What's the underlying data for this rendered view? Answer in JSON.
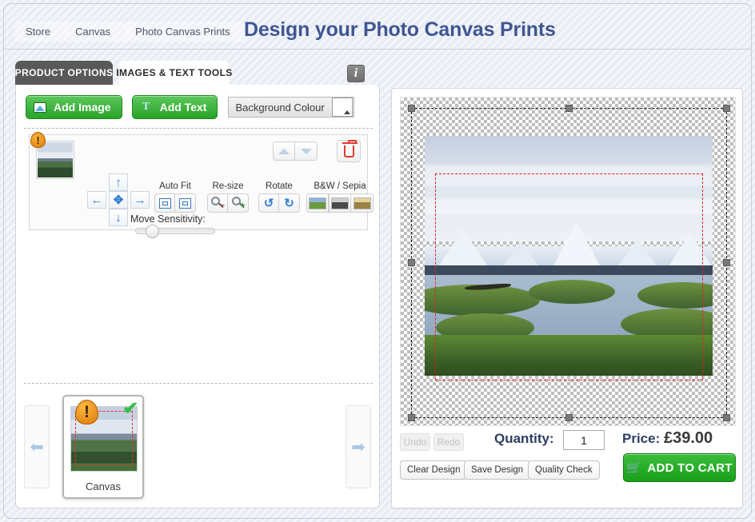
{
  "header": {
    "breadcrumb": [
      {
        "label": "Store"
      },
      {
        "label": "Canvas"
      },
      {
        "label": "Photo Canvas Prints"
      }
    ],
    "title": "Design your Photo Canvas Prints",
    "title_color": "#3f5693"
  },
  "tabs": [
    {
      "label": "PRODUCT OPTIONS",
      "active": false
    },
    {
      "label": "IMAGES & TEXT TOOLS",
      "active": true
    }
  ],
  "info_button": {
    "label": "i",
    "icon": "info-icon"
  },
  "toolbar": {
    "add_image_label": "Add Image",
    "add_image_icon": "image-icon",
    "add_text_label": "Add Text",
    "add_text_icon": "text-icon",
    "background_colour_label": "Background Colour",
    "background_colour_value": "#ffffff",
    "background_colour_caret": "caret-up-icon"
  },
  "image_card": {
    "warning_icon": "warning-icon",
    "warning_glyph": "!",
    "thumbnail_name": "image-thumbnail",
    "layer_up_icon": "triangle-up-icon",
    "layer_down_icon": "triangle-down-icon",
    "delete_icon": "trash-icon",
    "dpad": {
      "up_icon": "arrow-up-icon",
      "down_icon": "arrow-down-icon",
      "left_icon": "arrow-left-icon",
      "right_icon": "arrow-right-icon",
      "center_icon": "move-icon",
      "up_glyph": "↑",
      "down_glyph": "↓",
      "left_glyph": "←",
      "right_glyph": "→",
      "center_glyph": "✥"
    },
    "groups": [
      {
        "label": "Auto Fit",
        "buttons": [
          "fit-width-icon",
          "fit-height-icon"
        ]
      },
      {
        "label": "Re-size",
        "buttons": [
          "zoom-out-icon",
          "zoom-in-icon"
        ]
      },
      {
        "label": "Rotate",
        "buttons": [
          "rotate-left-icon",
          "rotate-right-icon"
        ]
      },
      {
        "label": "B&W / Sepia",
        "buttons": [
          "colour-swatch-icon",
          "bw-swatch-icon",
          "sepia-swatch-icon"
        ]
      }
    ],
    "autofit_label": "Auto Fit",
    "resize_label": "Re-size",
    "rotate_label": "Rotate",
    "bw_sepia_label": "B&W / Sepia",
    "rotate_left_glyph": "↺",
    "rotate_right_glyph": "↻",
    "move_sensitivity_label": "Move Sensitivity:",
    "move_sensitivity_value": 12
  },
  "page_strip": {
    "prev_icon": "arrow-left-icon",
    "next_icon": "arrow-right-icon",
    "prev_glyph": "⬅",
    "next_glyph": "➡",
    "thumbnail": {
      "label": "Canvas",
      "warning_glyph": "!",
      "check_glyph": "✔",
      "warning_icon": "warning-icon",
      "check_icon": "check-icon"
    }
  },
  "preview": {
    "canvas_name": "design-canvas",
    "selection_name": "selection-box",
    "safe_area_name": "safe-area-guide",
    "handles": 8
  },
  "actions": {
    "undo_label": "Undo",
    "redo_label": "Redo",
    "quantity_label": "Quantity:",
    "quantity_value": "1",
    "price_label": "Price:",
    "price_value": "£39.00",
    "clear_design_label": "Clear Design",
    "save_design_label": "Save Design",
    "quality_check_label": "Quality Check",
    "add_to_cart_label": "ADD TO CART",
    "cart_icon": "shopping-cart-icon",
    "cart_glyph": "🛒"
  },
  "colors": {
    "accent_green": "#27a327",
    "title_blue": "#3f5693",
    "warning_orange": "#e07a0c",
    "danger_red": "#e03a2f",
    "tab_dark": "#595959"
  }
}
